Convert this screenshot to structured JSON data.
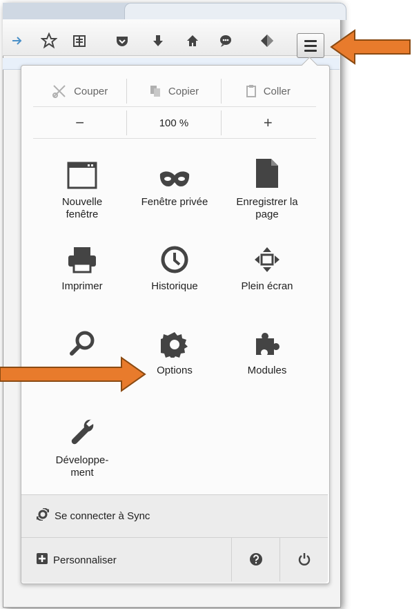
{
  "edit": {
    "cut": "Couper",
    "copy": "Copier",
    "paste": "Coller"
  },
  "zoom": {
    "minus": "−",
    "level": "100 %",
    "plus": "+"
  },
  "grid": {
    "new_window": "Nouvelle\nfenêtre",
    "private_window": "Fenêtre privée",
    "save_page": "Enregistrer la\npage",
    "print": "Imprimer",
    "history": "Historique",
    "fullscreen": "Plein écran",
    "find": "",
    "options": "Options",
    "addons": "Modules",
    "developer": "Développe-\nment"
  },
  "footer": {
    "sync": "Se connecter à Sync",
    "customize": "Personnaliser"
  },
  "colors": {
    "arrow": "#e87b2c",
    "icon": "#444444"
  },
  "icons": [
    "star-icon",
    "reading-list-icon",
    "pocket-icon",
    "download-icon",
    "home-icon",
    "chat-icon",
    "tag-icon",
    "hamburger-menu-icon"
  ]
}
